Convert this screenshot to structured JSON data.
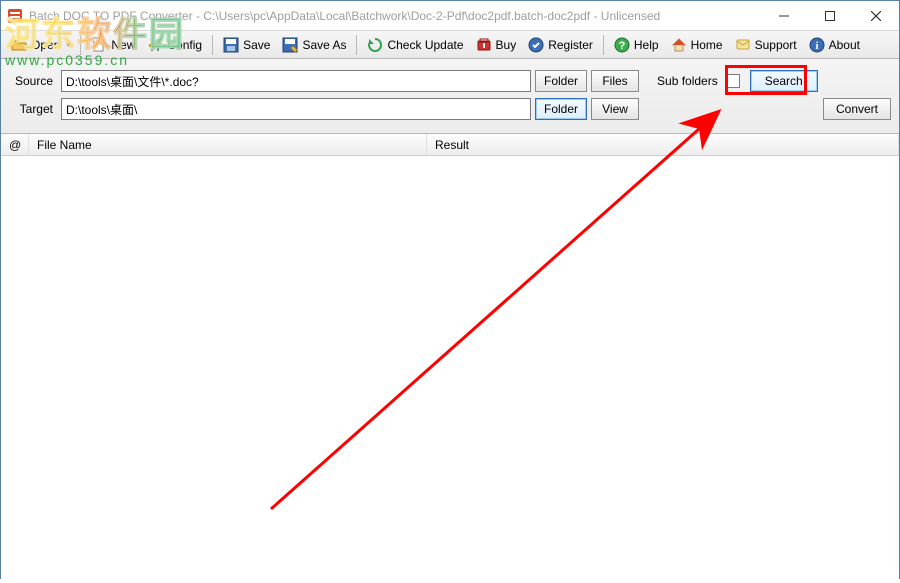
{
  "window": {
    "title": "Batch DOC TO PDF Converter - C:\\Users\\pc\\AppData\\Local\\Batchwork\\Doc-2-Pdf\\doc2pdf.batch-doc2pdf - Unlicensed"
  },
  "toolbar": {
    "open": "Open",
    "new": "New",
    "config": "Config",
    "save": "Save",
    "saveAs": "Save As",
    "checkUpdate": "Check Update",
    "buy": "Buy",
    "register": "Register",
    "help": "Help",
    "home": "Home",
    "support": "Support",
    "about": "About"
  },
  "form": {
    "sourceLabel": "Source",
    "sourceValue": "D:\\tools\\桌面\\文件\\*.doc?",
    "targetLabel": "Target",
    "targetValue": "D:\\tools\\桌面\\",
    "folderBtn": "Folder",
    "filesBtn": "Files",
    "viewBtn": "View",
    "subFoldersLabel": "Sub folders",
    "searchBtn": "Search",
    "convertBtn": "Convert"
  },
  "list": {
    "colAt": "@",
    "colFile": "File Name",
    "colResult": "Result"
  },
  "watermark": {
    "cn": "河东软件园",
    "url": "www.pc0359.cn"
  }
}
